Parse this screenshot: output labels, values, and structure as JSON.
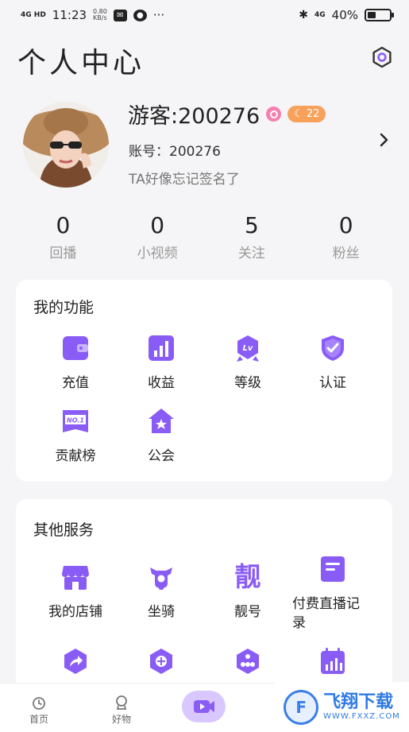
{
  "status_bar": {
    "signal": "4G HD",
    "time": "11:23",
    "speed_value": "0.80",
    "speed_unit": "KB/s",
    "more": "···",
    "network": "4G",
    "battery": "40%",
    "battery_level": 0.4
  },
  "header": {
    "title": "个人中心"
  },
  "profile": {
    "nickname": "游客:200276",
    "level": "22",
    "account": "账号：200276",
    "signature": "TA好像忘记签名了"
  },
  "stats": [
    {
      "value": "0",
      "label": "回播"
    },
    {
      "value": "0",
      "label": "小视频"
    },
    {
      "value": "5",
      "label": "关注"
    },
    {
      "value": "0",
      "label": "粉丝"
    }
  ],
  "my_functions": {
    "title": "我的功能",
    "items": [
      {
        "label": "充值",
        "icon": "wallet-icon"
      },
      {
        "label": "收益",
        "icon": "bar-chart-icon"
      },
      {
        "label": "等级",
        "icon": "level-badge-icon",
        "badge": "Lv"
      },
      {
        "label": "认证",
        "icon": "shield-check-icon"
      },
      {
        "label": "贡献榜",
        "icon": "ranking-banner-icon",
        "badge": "NO.1"
      },
      {
        "label": "公会",
        "icon": "guild-house-icon"
      }
    ]
  },
  "other_services": {
    "title": "其他服务",
    "items": [
      {
        "label": "我的店铺",
        "icon": "store-icon"
      },
      {
        "label": "坐骑",
        "icon": "scooter-icon"
      },
      {
        "label": "靓号",
        "icon": "pretty-number-icon",
        "glyph": "靓"
      },
      {
        "label": "付费直播记录",
        "label_line1": "付费直播记",
        "label_line2": "录",
        "icon": "record-icon"
      },
      {
        "label": "",
        "icon": "share-icon"
      },
      {
        "label": "",
        "icon": "plus-hex-icon"
      },
      {
        "label": "",
        "icon": "network-hex-icon"
      },
      {
        "label": "",
        "icon": "calendar-chart-icon"
      }
    ]
  },
  "bottom_nav": [
    {
      "label": "首页",
      "icon": "home-icon"
    },
    {
      "label": "好物",
      "icon": "goods-icon"
    },
    {
      "label": "",
      "icon": "live-camera-icon"
    }
  ],
  "watermark": {
    "text": "飞翔下载",
    "sub": "WWW.FXXZ.COM",
    "logo": "F"
  },
  "colors": {
    "accent": "#8a5cf6",
    "accent_light": "#d9c8ff",
    "level_badge": "#f7a15b",
    "gender": "#f47fb0"
  }
}
